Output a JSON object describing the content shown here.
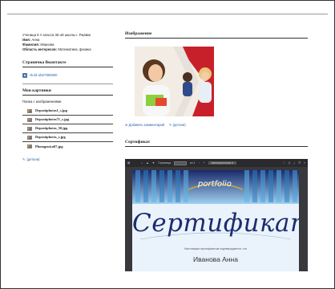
{
  "profile": {
    "desc": "Ученица 9 А класса 35-ой школы г. Ржавке",
    "name_label": "Имя:",
    "name": "Анна",
    "surname_label": "Фамилия:",
    "surname": "Иванова",
    "interests_label": "Область интересов:",
    "interests": "Математика, физика"
  },
  "vk": {
    "section_title": "Страничка Вконтакте",
    "link": "vk.ldi-id107550900"
  },
  "files": {
    "section_title": "Мои картинки",
    "folder_label": "Папка с изображениями",
    "items": [
      "Depositphotos1_s.jpg",
      "Depositphotos71_s.jpg",
      "Depositphotos_50.jpg",
      "Depositphotos_s.jpg",
      "Photogenica07.jpg"
    ],
    "details_link": "(детали)"
  },
  "image_section": {
    "title": "Изображение",
    "add_comment": "Добавить комментарий",
    "details": "(детали)"
  },
  "certificate": {
    "title": "Сертификат",
    "toolbar_page_label": "Страница",
    "toolbar_page_total": "из 1",
    "toolbar_zoom": "Автоматически",
    "logo_text": "portfolio",
    "word": "Сертификат",
    "line": "Настоящим сертификатом подтверждается, что",
    "name": "Иванова Анна"
  }
}
